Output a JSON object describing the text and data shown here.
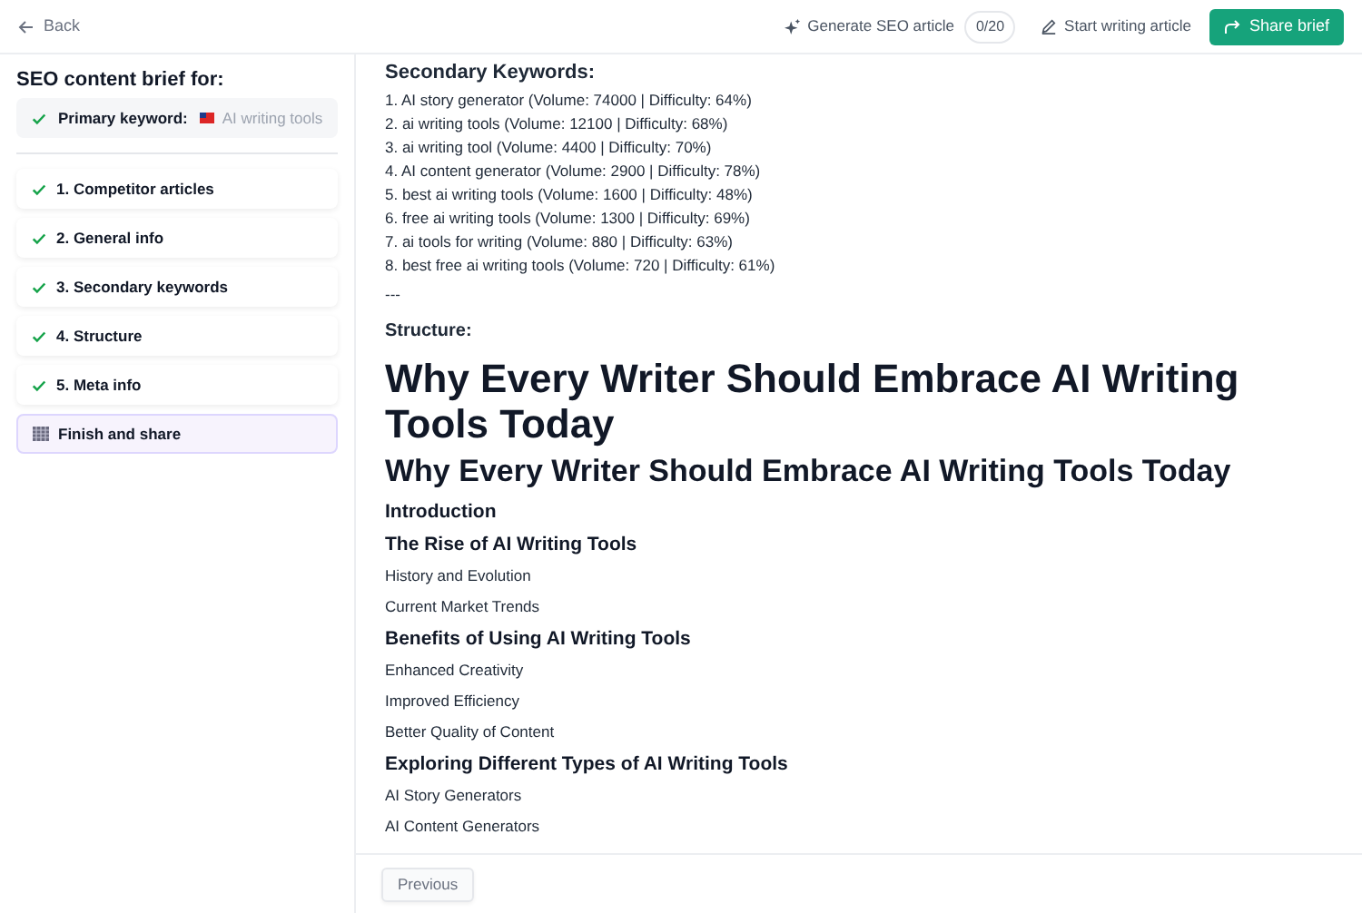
{
  "topbar": {
    "back": "Back",
    "generate": {
      "label": "Generate SEO article",
      "count": "0/20"
    },
    "start": "Start writing article",
    "share": "Share brief"
  },
  "sidebar": {
    "title": "SEO content brief for:",
    "primary": {
      "label": "Primary keyword:",
      "value": "AI writing tools",
      "done": true
    },
    "steps": [
      {
        "label": "1. Competitor articles",
        "done": true,
        "selected": false
      },
      {
        "label": "2. General info",
        "done": true,
        "selected": false
      },
      {
        "label": "3. Secondary keywords",
        "done": true,
        "selected": false
      },
      {
        "label": "4. Structure",
        "done": true,
        "selected": false
      },
      {
        "label": "5. Meta info",
        "done": true,
        "selected": false
      },
      {
        "label": "Finish and share",
        "done": false,
        "selected": true
      }
    ]
  },
  "content": [
    {
      "kind": "label",
      "text": "Secondary Keywords:"
    },
    {
      "kind": "line",
      "text": "1. AI story generator (Volume: 74000 | Difficulty: 64%)"
    },
    {
      "kind": "line",
      "text": "2. ai writing tools (Volume: 12100 | Difficulty: 68%)"
    },
    {
      "kind": "line",
      "text": "3. ai writing tool (Volume: 4400 | Difficulty: 70%)"
    },
    {
      "kind": "line",
      "text": "4. AI content generator (Volume: 2900 | Difficulty: 78%)"
    },
    {
      "kind": "line",
      "text": "5. best ai writing tools (Volume: 1600 | Difficulty: 48%)"
    },
    {
      "kind": "line",
      "text": "6. free ai writing tools (Volume: 1300 | Difficulty: 69%)"
    },
    {
      "kind": "line",
      "text": "7. ai tools for writing (Volume: 880 | Difficulty: 63%)"
    },
    {
      "kind": "line",
      "text": "8. best free ai writing tools (Volume: 720 | Difficulty: 61%)"
    },
    {
      "kind": "rule",
      "text": "---"
    },
    {
      "kind": "label2",
      "text": "Structure:"
    },
    {
      "kind": "h1",
      "text": "Why Every Writer Should Embrace AI Writing Tools Today"
    },
    {
      "kind": "h2",
      "text": "Why Every Writer Should Embrace AI Writing Tools Today"
    },
    {
      "kind": "h3",
      "text": "Introduction"
    },
    {
      "kind": "h3",
      "text": "The Rise of AI Writing Tools"
    },
    {
      "kind": "p",
      "text": "History and Evolution"
    },
    {
      "kind": "p",
      "text": "Current Market Trends"
    },
    {
      "kind": "h3",
      "text": "Benefits of Using AI Writing Tools"
    },
    {
      "kind": "p",
      "text": "Enhanced Creativity"
    },
    {
      "kind": "p",
      "text": "Improved Efficiency"
    },
    {
      "kind": "p",
      "text": "Better Quality of Content"
    },
    {
      "kind": "h3",
      "text": "Exploring Different Types of AI Writing Tools"
    },
    {
      "kind": "p",
      "text": "AI Story Generators"
    },
    {
      "kind": "p",
      "text": "AI Content Generators"
    }
  ],
  "footer": {
    "previous": "Previous"
  }
}
